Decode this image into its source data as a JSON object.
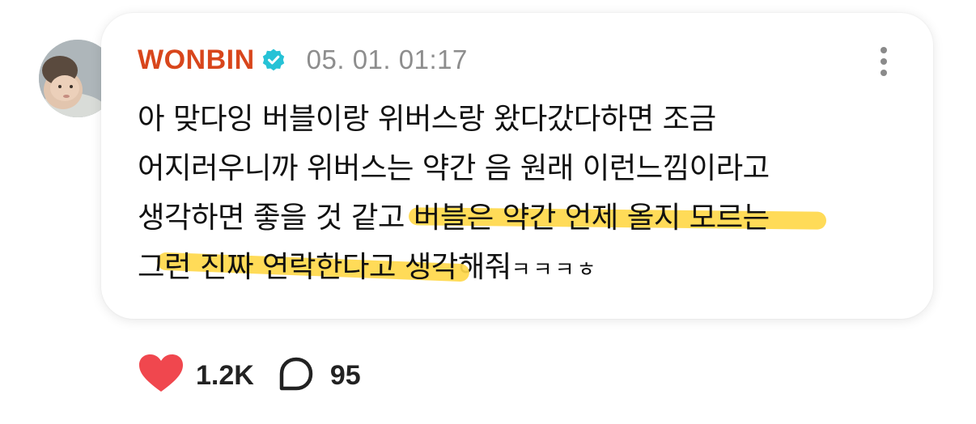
{
  "post": {
    "author": "WONBIN",
    "verified_icon": "verified-badge-icon",
    "timestamp": "05. 01. 01:17",
    "lines": {
      "l1": "아 맞다잉 버블이랑 위버스랑 왔다갔다하면 조금",
      "l2": "어지러우니까 위버스는 약간 음 원래 이런느낌이라고",
      "l3_plain": "생각하면 좋을 것 같고 ",
      "l3_highlight": "버블은 약간 언제 올지 모르는",
      "l4_highlight": "그런 진짜 연락한다고 생각",
      "l4_plain": "해줘",
      "l4_suffix": "ㅋㅋㅋㅎ"
    },
    "highlight_color": "#ffd84a",
    "author_color": "#d8461c"
  },
  "reactions": {
    "likes": "1.2K",
    "comments": "95",
    "like_icon": "heart-icon",
    "comment_icon": "comment-bubble-icon"
  }
}
